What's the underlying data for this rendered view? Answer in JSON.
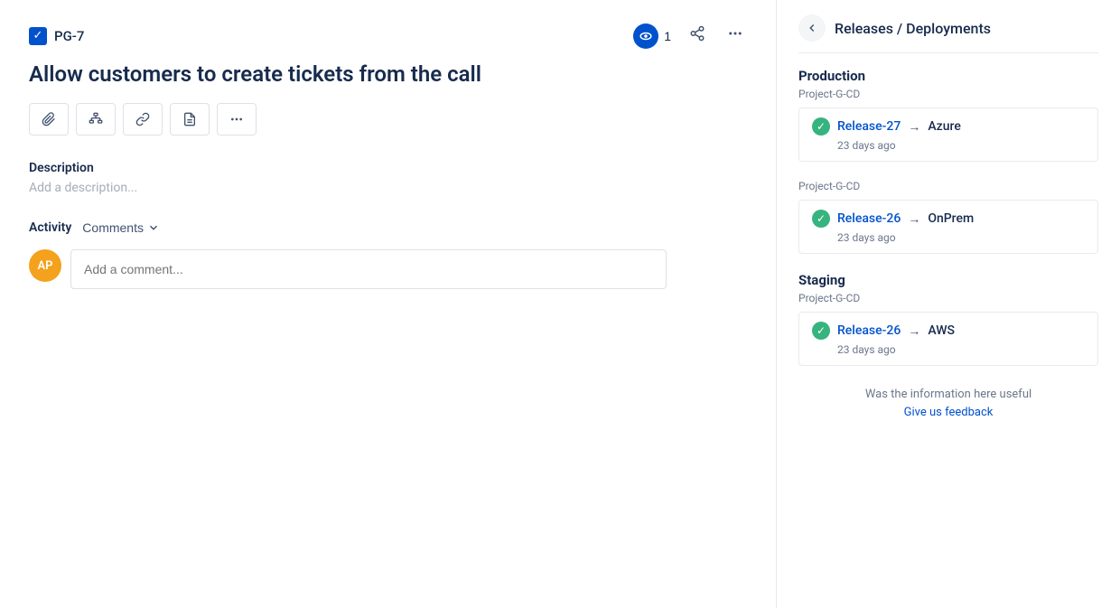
{
  "header": {
    "ticket_id": "PG-7",
    "watch_count": "1",
    "share_label": "share",
    "more_label": "more"
  },
  "title": "Allow customers to create tickets from the call",
  "toolbar": {
    "attachment_label": "attachment",
    "hierarchy_label": "hierarchy",
    "link_label": "link",
    "document_label": "document",
    "more_label": "more"
  },
  "description": {
    "label": "Description",
    "placeholder": "Add a description..."
  },
  "activity": {
    "label": "Activity",
    "comments_label": "Comments",
    "comment_placeholder": "Add a comment...",
    "avatar_initials": "AP"
  },
  "side": {
    "back_label": "back",
    "title": "Releases / Deployments",
    "environments": [
      {
        "name": "Production",
        "project": "Project-G-CD",
        "releases": [
          {
            "name": "Release-27",
            "target": "Azure",
            "time": "23 days ago"
          }
        ]
      },
      {
        "name": "",
        "project": "Project-G-CD",
        "releases": [
          {
            "name": "Release-26",
            "target": "OnPrem",
            "time": "23 days ago"
          }
        ]
      },
      {
        "name": "Staging",
        "project": "Project-G-CD",
        "releases": [
          {
            "name": "Release-26",
            "target": "AWS",
            "time": "23 days ago"
          }
        ]
      }
    ],
    "feedback_question": "Was the information here useful",
    "feedback_link": "Give us feedback"
  }
}
